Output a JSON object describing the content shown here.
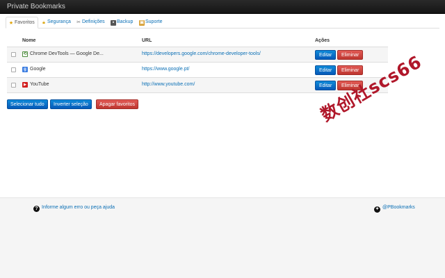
{
  "app": {
    "title": "Private Bookmarks"
  },
  "tabs": [
    {
      "label": "Favoritos",
      "icon": "star-icon",
      "active": true
    },
    {
      "label": "Segurança",
      "icon": "lock-icon"
    },
    {
      "label": "Definições",
      "icon": "tools-icon"
    },
    {
      "label": "Backup",
      "icon": "disk-icon"
    },
    {
      "label": "Suporte",
      "icon": "box-icon"
    }
  ],
  "table": {
    "headers": {
      "name": "Nome",
      "url": "URL",
      "actions": "Ações"
    },
    "rows": [
      {
        "name": "Chrome DevTools — Google De...",
        "url": "https://developers.google.com/chrome-developer-tools/",
        "favicon": "chrome-devtools-icon"
      },
      {
        "name": "Google",
        "url": "https://www.google.pt/",
        "favicon": "google-icon"
      },
      {
        "name": "YouTube",
        "url": "http://www.youtube.com/",
        "favicon": "youtube-icon"
      }
    ],
    "edit_label": "Editar",
    "delete_label": "Eliminar"
  },
  "actions": {
    "select_all": "Selecionar tudo",
    "invert": "Inverter seleção",
    "delete_favorites": "Apagar favoritos"
  },
  "watermark": "数创社scs66",
  "footer": {
    "help_text": "Informe algum erro ou peça ajuda",
    "twitter": "@PBookmarks"
  },
  "colors": {
    "link": "#0a6fb5",
    "primary": "#0659b8",
    "danger": "#bd352f",
    "topbar": "#1b1b1b"
  }
}
